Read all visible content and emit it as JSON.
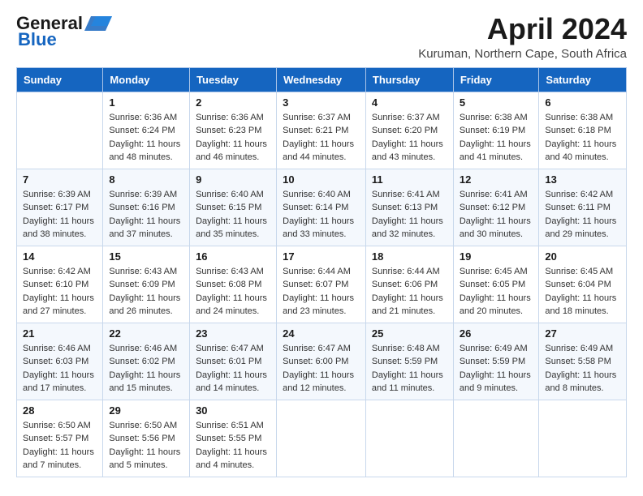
{
  "header": {
    "logo_general": "General",
    "logo_blue": "Blue",
    "month_title": "April 2024",
    "location": "Kuruman, Northern Cape, South Africa"
  },
  "days_of_week": [
    "Sunday",
    "Monday",
    "Tuesday",
    "Wednesday",
    "Thursday",
    "Friday",
    "Saturday"
  ],
  "weeks": [
    [
      {
        "day": "",
        "sunrise": "",
        "sunset": "",
        "daylight": ""
      },
      {
        "day": "1",
        "sunrise": "Sunrise: 6:36 AM",
        "sunset": "Sunset: 6:24 PM",
        "daylight": "Daylight: 11 hours and 48 minutes."
      },
      {
        "day": "2",
        "sunrise": "Sunrise: 6:36 AM",
        "sunset": "Sunset: 6:23 PM",
        "daylight": "Daylight: 11 hours and 46 minutes."
      },
      {
        "day": "3",
        "sunrise": "Sunrise: 6:37 AM",
        "sunset": "Sunset: 6:21 PM",
        "daylight": "Daylight: 11 hours and 44 minutes."
      },
      {
        "day": "4",
        "sunrise": "Sunrise: 6:37 AM",
        "sunset": "Sunset: 6:20 PM",
        "daylight": "Daylight: 11 hours and 43 minutes."
      },
      {
        "day": "5",
        "sunrise": "Sunrise: 6:38 AM",
        "sunset": "Sunset: 6:19 PM",
        "daylight": "Daylight: 11 hours and 41 minutes."
      },
      {
        "day": "6",
        "sunrise": "Sunrise: 6:38 AM",
        "sunset": "Sunset: 6:18 PM",
        "daylight": "Daylight: 11 hours and 40 minutes."
      }
    ],
    [
      {
        "day": "7",
        "sunrise": "Sunrise: 6:39 AM",
        "sunset": "Sunset: 6:17 PM",
        "daylight": "Daylight: 11 hours and 38 minutes."
      },
      {
        "day": "8",
        "sunrise": "Sunrise: 6:39 AM",
        "sunset": "Sunset: 6:16 PM",
        "daylight": "Daylight: 11 hours and 37 minutes."
      },
      {
        "day": "9",
        "sunrise": "Sunrise: 6:40 AM",
        "sunset": "Sunset: 6:15 PM",
        "daylight": "Daylight: 11 hours and 35 minutes."
      },
      {
        "day": "10",
        "sunrise": "Sunrise: 6:40 AM",
        "sunset": "Sunset: 6:14 PM",
        "daylight": "Daylight: 11 hours and 33 minutes."
      },
      {
        "day": "11",
        "sunrise": "Sunrise: 6:41 AM",
        "sunset": "Sunset: 6:13 PM",
        "daylight": "Daylight: 11 hours and 32 minutes."
      },
      {
        "day": "12",
        "sunrise": "Sunrise: 6:41 AM",
        "sunset": "Sunset: 6:12 PM",
        "daylight": "Daylight: 11 hours and 30 minutes."
      },
      {
        "day": "13",
        "sunrise": "Sunrise: 6:42 AM",
        "sunset": "Sunset: 6:11 PM",
        "daylight": "Daylight: 11 hours and 29 minutes."
      }
    ],
    [
      {
        "day": "14",
        "sunrise": "Sunrise: 6:42 AM",
        "sunset": "Sunset: 6:10 PM",
        "daylight": "Daylight: 11 hours and 27 minutes."
      },
      {
        "day": "15",
        "sunrise": "Sunrise: 6:43 AM",
        "sunset": "Sunset: 6:09 PM",
        "daylight": "Daylight: 11 hours and 26 minutes."
      },
      {
        "day": "16",
        "sunrise": "Sunrise: 6:43 AM",
        "sunset": "Sunset: 6:08 PM",
        "daylight": "Daylight: 11 hours and 24 minutes."
      },
      {
        "day": "17",
        "sunrise": "Sunrise: 6:44 AM",
        "sunset": "Sunset: 6:07 PM",
        "daylight": "Daylight: 11 hours and 23 minutes."
      },
      {
        "day": "18",
        "sunrise": "Sunrise: 6:44 AM",
        "sunset": "Sunset: 6:06 PM",
        "daylight": "Daylight: 11 hours and 21 minutes."
      },
      {
        "day": "19",
        "sunrise": "Sunrise: 6:45 AM",
        "sunset": "Sunset: 6:05 PM",
        "daylight": "Daylight: 11 hours and 20 minutes."
      },
      {
        "day": "20",
        "sunrise": "Sunrise: 6:45 AM",
        "sunset": "Sunset: 6:04 PM",
        "daylight": "Daylight: 11 hours and 18 minutes."
      }
    ],
    [
      {
        "day": "21",
        "sunrise": "Sunrise: 6:46 AM",
        "sunset": "Sunset: 6:03 PM",
        "daylight": "Daylight: 11 hours and 17 minutes."
      },
      {
        "day": "22",
        "sunrise": "Sunrise: 6:46 AM",
        "sunset": "Sunset: 6:02 PM",
        "daylight": "Daylight: 11 hours and 15 minutes."
      },
      {
        "day": "23",
        "sunrise": "Sunrise: 6:47 AM",
        "sunset": "Sunset: 6:01 PM",
        "daylight": "Daylight: 11 hours and 14 minutes."
      },
      {
        "day": "24",
        "sunrise": "Sunrise: 6:47 AM",
        "sunset": "Sunset: 6:00 PM",
        "daylight": "Daylight: 11 hours and 12 minutes."
      },
      {
        "day": "25",
        "sunrise": "Sunrise: 6:48 AM",
        "sunset": "Sunset: 5:59 PM",
        "daylight": "Daylight: 11 hours and 11 minutes."
      },
      {
        "day": "26",
        "sunrise": "Sunrise: 6:49 AM",
        "sunset": "Sunset: 5:59 PM",
        "daylight": "Daylight: 11 hours and 9 minutes."
      },
      {
        "day": "27",
        "sunrise": "Sunrise: 6:49 AM",
        "sunset": "Sunset: 5:58 PM",
        "daylight": "Daylight: 11 hours and 8 minutes."
      }
    ],
    [
      {
        "day": "28",
        "sunrise": "Sunrise: 6:50 AM",
        "sunset": "Sunset: 5:57 PM",
        "daylight": "Daylight: 11 hours and 7 minutes."
      },
      {
        "day": "29",
        "sunrise": "Sunrise: 6:50 AM",
        "sunset": "Sunset: 5:56 PM",
        "daylight": "Daylight: 11 hours and 5 minutes."
      },
      {
        "day": "30",
        "sunrise": "Sunrise: 6:51 AM",
        "sunset": "Sunset: 5:55 PM",
        "daylight": "Daylight: 11 hours and 4 minutes."
      },
      {
        "day": "",
        "sunrise": "",
        "sunset": "",
        "daylight": ""
      },
      {
        "day": "",
        "sunrise": "",
        "sunset": "",
        "daylight": ""
      },
      {
        "day": "",
        "sunrise": "",
        "sunset": "",
        "daylight": ""
      },
      {
        "day": "",
        "sunrise": "",
        "sunset": "",
        "daylight": ""
      }
    ]
  ]
}
